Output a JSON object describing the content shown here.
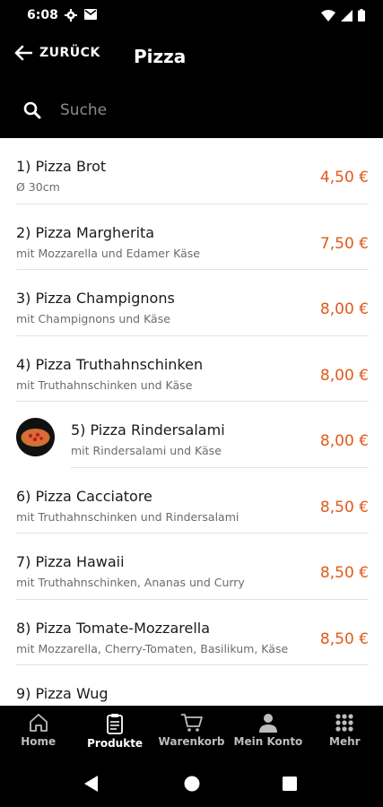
{
  "status": {
    "time": "6:08"
  },
  "app_bar": {
    "back_label": "ZURÜCK",
    "title": "Pizza"
  },
  "search": {
    "placeholder": "Suche"
  },
  "products": [
    {
      "title": "1) Pizza Brot",
      "desc": "Ø 30cm",
      "price": "4,50 €"
    },
    {
      "title": "2) Pizza Margherita",
      "desc": "mit Mozzarella und Edamer Käse",
      "price": "7,50 €"
    },
    {
      "title": "3) Pizza Champignons",
      "desc": "mit Champignons und Käse",
      "price": "8,00 €"
    },
    {
      "title": "4) Pizza Truthahnschinken",
      "desc": "mit Truthahnschinken und Käse",
      "price": "8,00 €"
    },
    {
      "title": "5) Pizza Rindersalami",
      "desc": "mit Rindersalami und Käse",
      "price": "8,00 €"
    },
    {
      "title": "6) Pizza Cacciatore",
      "desc": "mit Truthahnschinken und Rindersalami",
      "price": "8,50 €"
    },
    {
      "title": "7) Pizza Hawaii",
      "desc": "mit Truthahnschinken, Ananas und Curry",
      "price": "8,50 €"
    },
    {
      "title": "8) Pizza Tomate-Mozzarella",
      "desc": "mit Mozzarella, Cherry-Tomaten, Basilikum, Käse",
      "price": "8,50 €"
    },
    {
      "title": "9) Pizza Wug",
      "desc": "",
      "price": ""
    }
  ],
  "bottom_nav": [
    {
      "label": "Home",
      "icon": "home-icon"
    },
    {
      "label": "Produkte",
      "icon": "clipboard-icon"
    },
    {
      "label": "Warenkorb",
      "icon": "cart-icon"
    },
    {
      "label": "Mein Konto",
      "icon": "user-icon"
    },
    {
      "label": "Mehr",
      "icon": "grid-icon"
    }
  ],
  "active_nav": "Produkte",
  "colors": {
    "accent_price": "#e05a1b",
    "bar_bg": "#000000"
  }
}
